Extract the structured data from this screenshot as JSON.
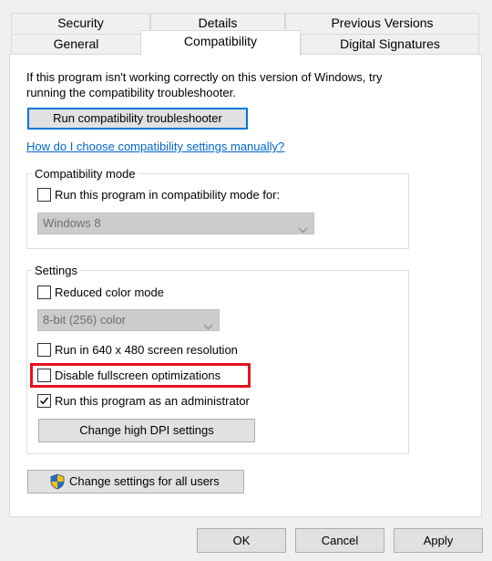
{
  "tabs": {
    "row1": [
      {
        "label": "Security"
      },
      {
        "label": "Details"
      },
      {
        "label": "Previous Versions"
      }
    ],
    "row2": [
      {
        "label": "General"
      },
      {
        "label": "Compatibility",
        "active": true
      },
      {
        "label": "Digital Signatures"
      }
    ]
  },
  "intro": {
    "line1": "If this program isn't working correctly on this version of Windows, try",
    "line2": "running the compatibility troubleshooter."
  },
  "troubleshooter_button": "Run compatibility troubleshooter",
  "manual_link": "How do I choose compatibility settings manually?",
  "compatibility_mode": {
    "legend": "Compatibility mode",
    "checkbox_label": "Run this program in compatibility mode for:",
    "checked": false,
    "selected_os": "Windows 8",
    "disabled": true
  },
  "settings": {
    "legend": "Settings",
    "reduced_color": {
      "label": "Reduced color mode",
      "checked": false
    },
    "color_select": {
      "value": "8-bit (256) color",
      "disabled": true
    },
    "resolution": {
      "label": "Run in 640 x 480 screen resolution",
      "checked": false
    },
    "fullscreen": {
      "label": "Disable fullscreen optimizations",
      "checked": false,
      "highlighted": true
    },
    "admin": {
      "label": "Run this program as an administrator",
      "checked": true
    },
    "dpi_button": "Change high DPI settings"
  },
  "all_users_button": "Change settings for all users",
  "footer": {
    "ok": "OK",
    "cancel": "Cancel",
    "apply": "Apply"
  },
  "colors": {
    "highlight": "#e81123",
    "link": "#0066cc",
    "focus": "#0078d7",
    "shield_blue": "#2b6cc4",
    "shield_yellow": "#f5c400"
  }
}
